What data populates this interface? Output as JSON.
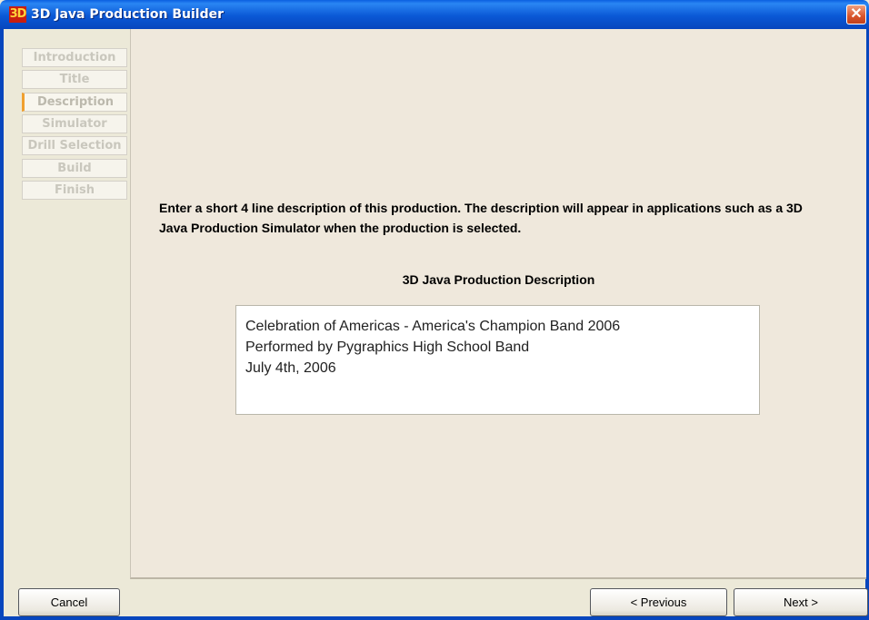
{
  "window": {
    "icon_label": "3D",
    "title": "3D Java Production Builder",
    "close_symbol": "✕"
  },
  "sidebar": {
    "steps": [
      {
        "label": "Introduction"
      },
      {
        "label": "Title"
      },
      {
        "label": "Description"
      },
      {
        "label": "Simulator"
      },
      {
        "label": "Drill Selection"
      },
      {
        "label": "Build"
      },
      {
        "label": "Finish"
      }
    ],
    "active_index": 2
  },
  "main": {
    "instructions": "Enter a short 4 line description of this production.  The description will appear in applications such as a 3D Java Production Simulator when the production is selected.",
    "description_heading": "3D Java Production Description",
    "description_lines": [
      "Celebration of Americas - America's Champion Band 2006",
      "Performed by Pygraphics High School Band",
      "July 4th, 2006"
    ]
  },
  "footer": {
    "cancel_label": "Cancel",
    "previous_label": "< Previous",
    "next_label": "Next >"
  },
  "colors": {
    "titlebar": "#0a58d6",
    "panel_background": "#efe8dc",
    "active_step_marker": "#f0a030"
  }
}
